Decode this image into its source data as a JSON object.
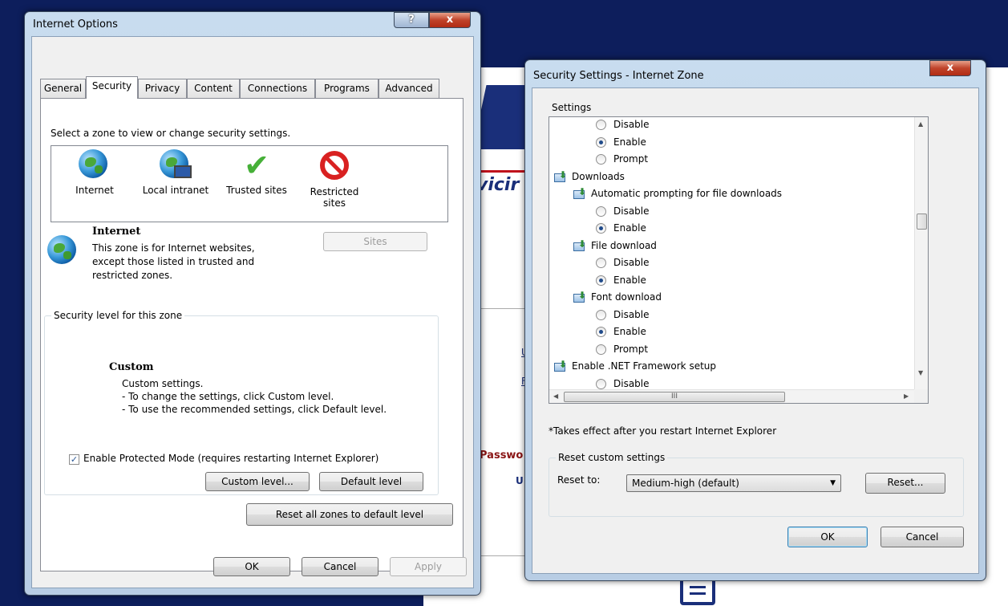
{
  "background": {
    "partial_word": "vicir",
    "link_a": "U",
    "link_b": "F",
    "password_label": "Passwo",
    "user_label": "U"
  },
  "internet_options": {
    "title": "Internet Options",
    "help_label": "?",
    "close_label": "x",
    "tabs": [
      "General",
      "Security",
      "Privacy",
      "Content",
      "Connections",
      "Programs",
      "Advanced"
    ],
    "active_tab": "Security",
    "zone_prompt": "Select a zone to view or change security settings.",
    "zones": [
      {
        "label": "Internet",
        "icon": "globe-icon"
      },
      {
        "label": "Local intranet",
        "icon": "intranet-icon"
      },
      {
        "label": "Trusted sites",
        "icon": "checkmark-icon"
      },
      {
        "label": "Restricted sites",
        "icon": "restricted-icon"
      }
    ],
    "selected_zone": {
      "name": "Internet",
      "description": "This zone is for Internet websites, except those listed in trusted and restricted zones."
    },
    "sites_button": "Sites",
    "security_level_group": "Security level for this zone",
    "level_title": "Custom",
    "level_lines": [
      "Custom settings.",
      "- To change the settings, click Custom level.",
      "- To use the recommended settings, click Default level."
    ],
    "protected_mode_label": "Enable Protected Mode (requires restarting Internet Explorer)",
    "protected_mode_checked": true,
    "custom_level_button": "Custom level...",
    "default_level_button": "Default level",
    "reset_all_button": "Reset all zones to default level",
    "ok_button": "OK",
    "cancel_button": "Cancel",
    "apply_button": "Apply"
  },
  "security_settings": {
    "title": "Security Settings - Internet Zone",
    "close_label": "x",
    "settings_group": "Settings",
    "items": [
      {
        "type": "radio",
        "label": "Disable",
        "checked": false
      },
      {
        "type": "radio",
        "label": "Enable",
        "checked": true
      },
      {
        "type": "radio",
        "label": "Prompt",
        "checked": false
      },
      {
        "type": "category",
        "label": "Downloads"
      },
      {
        "type": "setting",
        "label": "Automatic prompting for file downloads"
      },
      {
        "type": "radio",
        "label": "Disable",
        "checked": false
      },
      {
        "type": "radio",
        "label": "Enable",
        "checked": true
      },
      {
        "type": "setting",
        "label": "File download"
      },
      {
        "type": "radio",
        "label": "Disable",
        "checked": false
      },
      {
        "type": "radio",
        "label": "Enable",
        "checked": true
      },
      {
        "type": "setting",
        "label": "Font download"
      },
      {
        "type": "radio",
        "label": "Disable",
        "checked": false
      },
      {
        "type": "radio",
        "label": "Enable",
        "checked": true
      },
      {
        "type": "radio",
        "label": "Prompt",
        "checked": false
      },
      {
        "type": "category",
        "label": "Enable .NET Framework setup"
      },
      {
        "type": "radio",
        "label": "Disable",
        "checked": false
      }
    ],
    "hscroll_grip": "III",
    "note": "*Takes effect after you restart Internet Explorer",
    "reset_group": "Reset custom settings",
    "reset_to_label": "Reset to:",
    "reset_to_value": "Medium-high (default)",
    "reset_button": "Reset...",
    "ok_button": "OK",
    "cancel_button": "Cancel"
  }
}
